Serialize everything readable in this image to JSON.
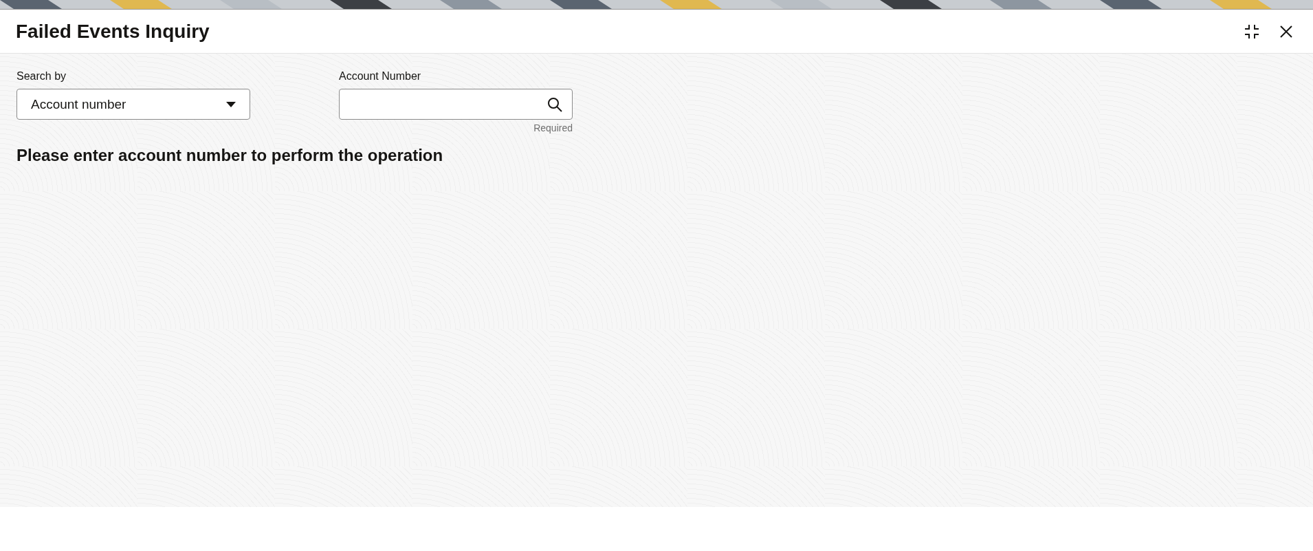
{
  "window": {
    "title": "Failed Events Inquiry"
  },
  "search_by": {
    "label": "Search by",
    "value": "Account number"
  },
  "account_number": {
    "label": "Account Number",
    "hint": "Required"
  },
  "message": "Please enter account number to perform the operation"
}
